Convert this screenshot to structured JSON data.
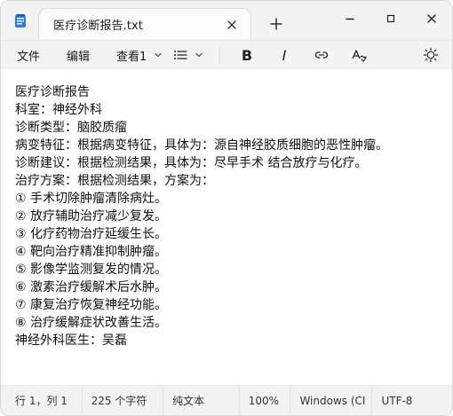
{
  "window": {
    "tab_title": "医疗诊断报告.txt"
  },
  "menu": {
    "items": [
      {
        "label": "文件"
      },
      {
        "label": "编辑"
      },
      {
        "label": "查看1"
      }
    ]
  },
  "toolbar": {
    "icons": {
      "list": "list-icon",
      "bold": "bold-icon",
      "italic": "italic-icon",
      "link": "link-icon",
      "spellcheck": "spellcheck-icon",
      "settings": "gear-icon"
    },
    "bold_glyph": "B",
    "italic_glyph": "I"
  },
  "document": {
    "lines": [
      "医疗诊断报告",
      "科室：神经外科",
      "诊断类型：脑胶质瘤",
      "病变特征：根据病变特征，具体为：源自神经胶质细胞的恶性肿瘤。",
      "诊断建议：根据检测结果，具体为：尽早手术 结合放疗与化疗。",
      "治疗方案：根据检测结果，方案为：",
      "① 手术切除肿瘤清除病灶。",
      "② 放疗辅助治疗减少复发。",
      "③ 化疗药物治疗延缓生长。",
      "④ 靶向治疗精准抑制肿瘤。",
      "⑤ 影像学监测复发的情况。",
      "⑥ 激素治疗缓解术后水肿。",
      "⑦ 康复治疗恢复神经功能。",
      "⑧ 治疗缓解症状改善生活。",
      "神经外科医生：吴磊"
    ]
  },
  "status": {
    "position": "行 1，列 1",
    "chars": "225 个字符",
    "format": "纯文本",
    "zoom": "100%",
    "line_endings": "Windows (CI",
    "encoding": "UTF-8"
  }
}
